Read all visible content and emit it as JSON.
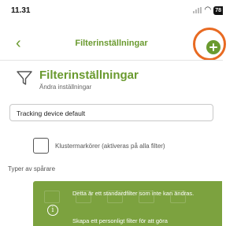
{
  "status_bar": {
    "time": "11.31",
    "battery": "78",
    "signal_icon": "signal-bars-icon",
    "wifi_icon": "wifi-icon"
  },
  "nav": {
    "back_icon": "chevron-left-icon",
    "back_glyph": "‹",
    "title": "Filterinställningar",
    "add_icon": "plus-circle-icon"
  },
  "header": {
    "icon": "filter-funnel-icon",
    "title": "Filterinställningar",
    "subtitle": "Ändra inställningar"
  },
  "form": {
    "name_value": "Tracking device default",
    "cluster_checkbox_label": "Klustermarkörer (aktiveras på alla filter)",
    "cluster_checked": false,
    "tracker_types_label": "Typer av spårare"
  },
  "info_banner": {
    "icon": "info-circle-icon",
    "icon_glyph": "i",
    "line1": "Detta är ett standardfilter som inte kan ändras.",
    "line2": "Skapa ett personligt filter för att göra"
  },
  "colors": {
    "brand_green": "#6a9a2f",
    "banner_green": "#7ca23f",
    "highlight_orange": "#e86a22"
  }
}
